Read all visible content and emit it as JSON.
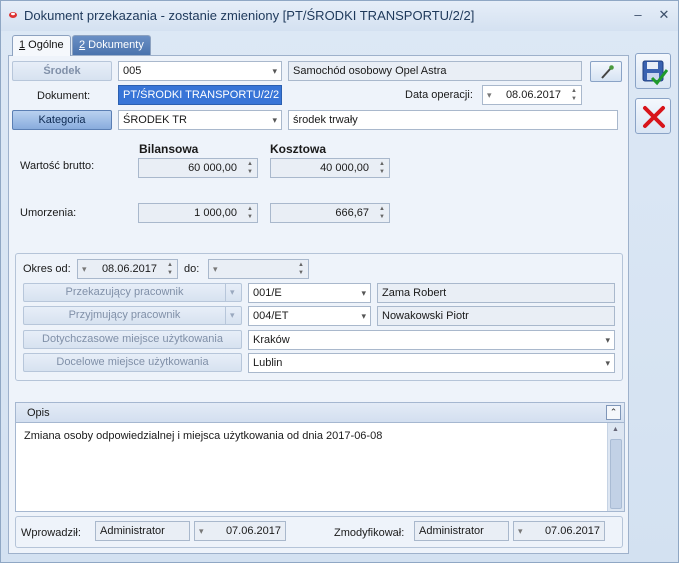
{
  "window": {
    "title": "Dokument przekazania - zostanie zmieniony [PT/ŚRODKI TRANSPORTU/2/2]",
    "minimize_glyph": "–",
    "close_glyph": "✕"
  },
  "tabs": [
    {
      "key": "1",
      "label": " Ogólne",
      "active": true
    },
    {
      "key": "2",
      "label": " Dokumenty",
      "active": false
    }
  ],
  "srodek": {
    "button_label": "Środek",
    "code": "005",
    "name": "Samochód osobowy Opel Astra"
  },
  "dokument": {
    "label": "Dokument:",
    "value": "PT/ŚRODKI TRANSPORTU/2/2",
    "date_label": "Data operacji:",
    "date_value": "08.06.2017"
  },
  "kategoria": {
    "button_label": "Kategoria",
    "code": "ŚRODEK TR",
    "name": "środek trwały"
  },
  "values": {
    "col_bilansowa": "Bilansowa",
    "col_kosztowa": "Kosztowa",
    "wartosc_label": "Wartość brutto:",
    "wartosc_bilansowa": "60 000,00",
    "wartosc_kosztowa": "40 000,00",
    "umorzenia_label": "Umorzenia:",
    "umorzenia_bilansowa": "1 000,00",
    "umorzenia_kosztowa": "666,67"
  },
  "okres": {
    "od_label": "Okres od:",
    "od_value": "08.06.2017",
    "do_label": "do:",
    "do_value": ""
  },
  "persons": {
    "przekazujacy_label": "Przekazujący pracownik",
    "przekazujacy_code": "001/E",
    "przekazujacy_name": "Zama Robert",
    "przyjmujacy_label": "Przyjmujący pracownik",
    "przyjmujacy_code": "004/ET",
    "przyjmujacy_name": "Nowakowski Piotr",
    "dotychczasowe_label": "Dotychczasowe miejsce użytkowania",
    "dotychczasowe_value": "Kraków",
    "docelowe_label": "Docelowe miejsce użytkowania",
    "docelowe_value": "Lublin"
  },
  "opis": {
    "label": "Opis",
    "text": "Zmiana osoby odpowiedzialnej i miejsca użytkowania od dnia 2017-06-08"
  },
  "footer": {
    "wprowadzil_label": "Wprowadził:",
    "wprowadzil_user": "Administrator",
    "wprowadzil_date": "07.06.2017",
    "zmodyfikowal_label": "Zmodyfikował:",
    "zmodyfikowal_user": "Administrator",
    "zmodyfikowal_date": "07.06.2017"
  },
  "icons": {
    "save": "floppy-save-icon",
    "cancel": "red-x-cancel-icon",
    "edit": "pen-edit-icon"
  }
}
